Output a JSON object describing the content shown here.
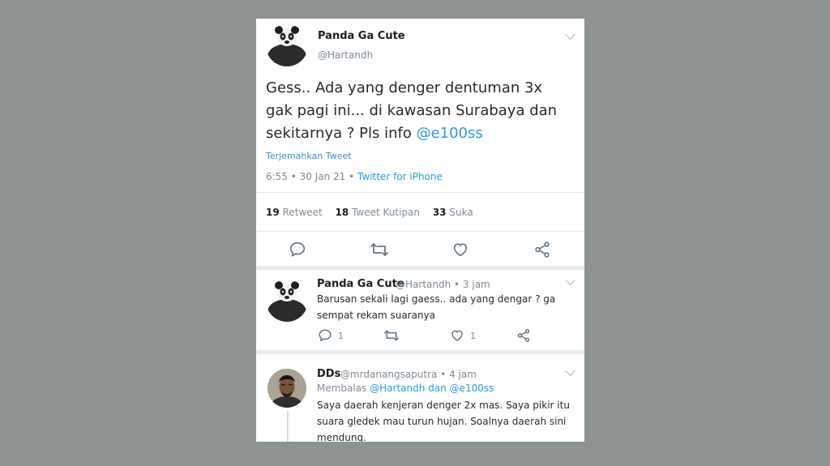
{
  "main_tweet": {
    "name": "Panda Ga Cute",
    "handle": "@Hartandh",
    "text_line1": "Gess.. Ada yang denger dentuman 3x",
    "text_line2": "gak pagi ini... di kawasan Surabaya dan",
    "text_line3": "sekitarnya ? Pls info ",
    "mention": "@e100ss",
    "translate": "Terjemahkan Tweet",
    "time": "6:55 • 30 Jan 21 • ",
    "source": "Twitter for iPhone",
    "retweet_count": "19",
    "retweet_label": "Retweet",
    "quote_count": "18",
    "quote_label": "Tweet Kutipan",
    "like_count": "33",
    "like_label": "Suka"
  },
  "reply1": {
    "name": "Panda Ga Cute",
    "handle_time": "@Hartandh • 3 jam",
    "text_line1": "Barusan sekali lagi gaess.. ada yang dengar ? ga",
    "text_line2": "sempat rekam suaranya",
    "reply_count": "1",
    "like_count": "1"
  },
  "reply2": {
    "name": "DDs",
    "handle_time": "@mrdanangsaputra • 4 jam",
    "replying_prefix": "Membalas ",
    "replying_to": "@Hartandh dan @e100ss",
    "text_line1": "Saya daerah kenjeran denger 2x mas. Saya pikir itu",
    "text_line2": "suara gledek mau turun hujan. Soalnya daerah sini",
    "text_line3": "mendung."
  },
  "icons": [
    "chevron-down-icon",
    "reply-icon",
    "retweet-icon",
    "like-icon",
    "share-icon"
  ],
  "colors": {
    "accent": "#2c9be0",
    "background": "#8d9490",
    "muted": "#7f8c97"
  }
}
